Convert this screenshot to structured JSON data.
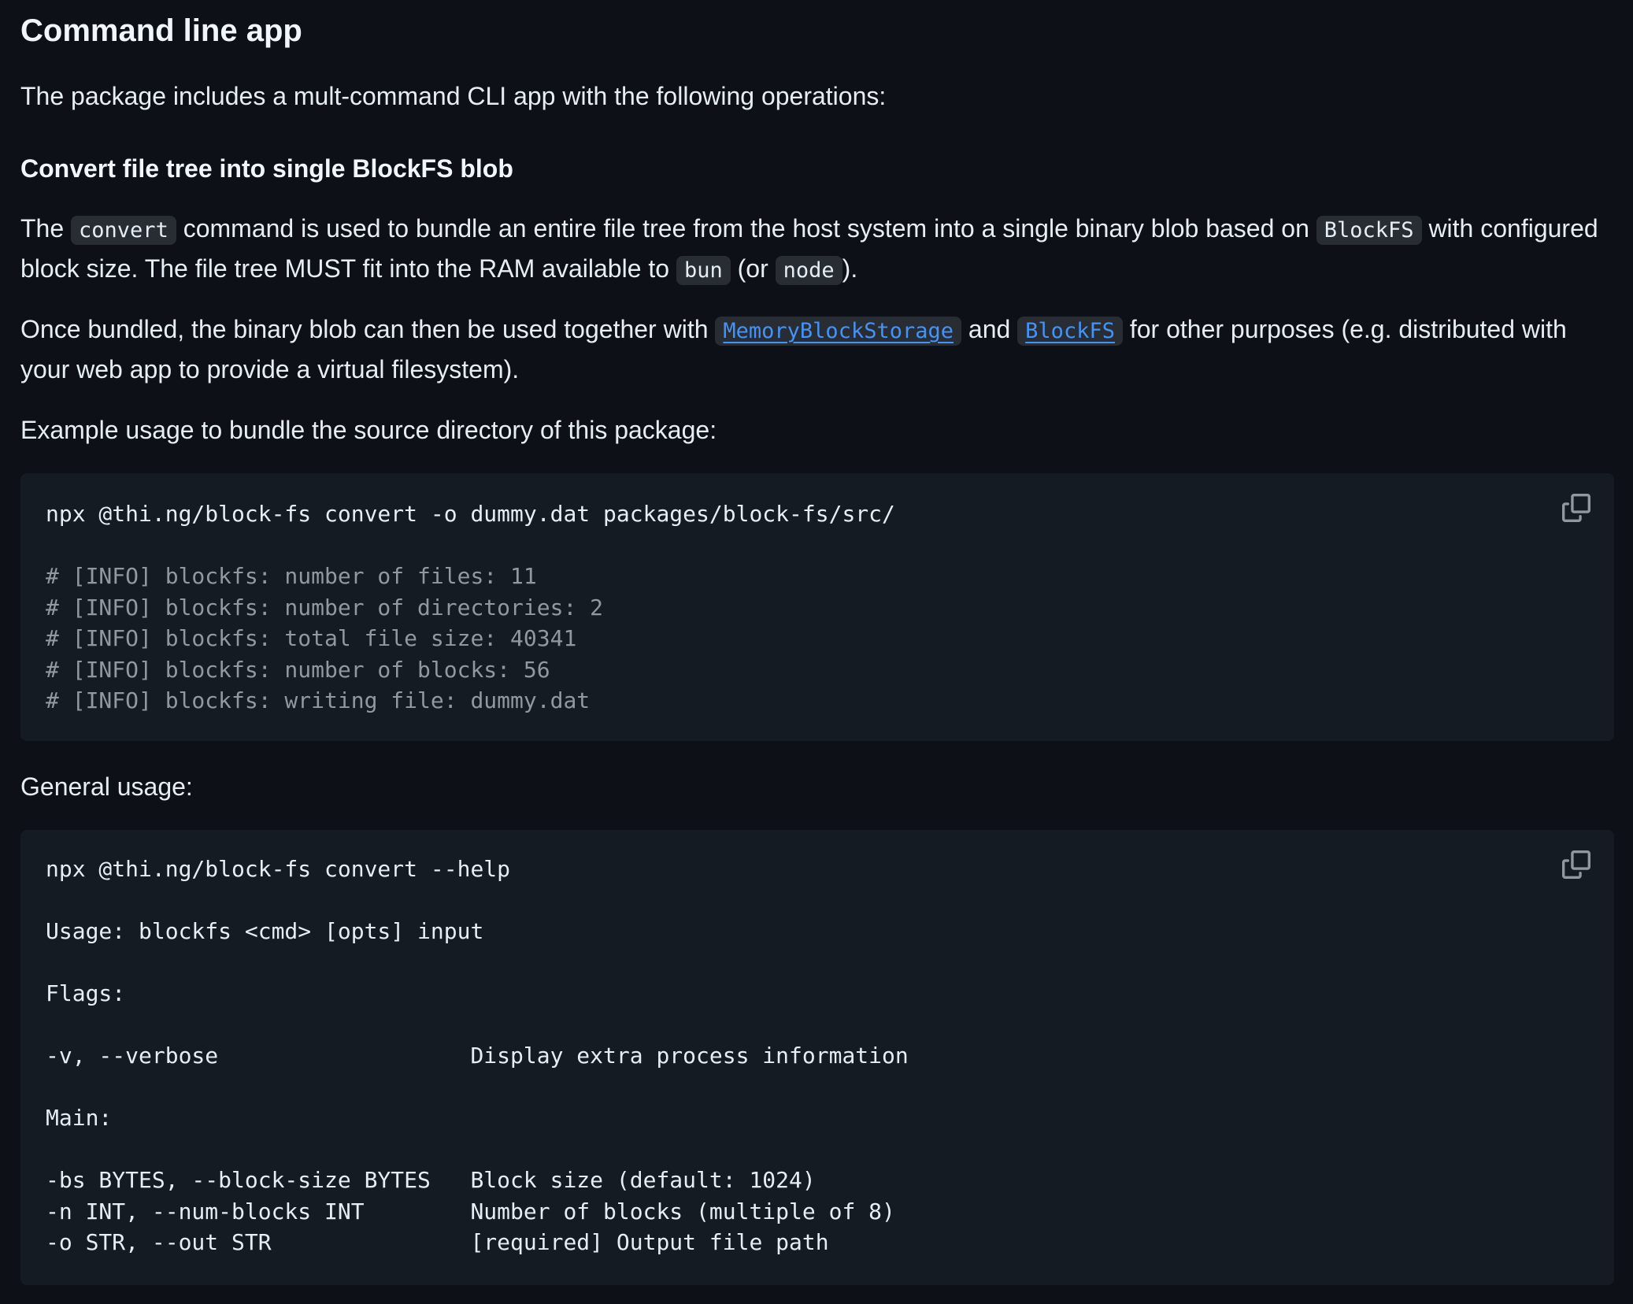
{
  "heading": "Command line app",
  "intro": "The package includes a mult-command CLI app with the following operations:",
  "subheading": "Convert file tree into single BlockFS blob",
  "para1": {
    "t1": "The ",
    "code1": "convert",
    "t2": " command is used to bundle an entire file tree from the host system into a single binary blob based on ",
    "code2": "BlockFS",
    "t3": " with configured block size. The file tree MUST fit into the RAM available to ",
    "code3": "bun",
    "t4": " (or ",
    "code4": "node",
    "t5": ")."
  },
  "para2": {
    "t1": "Once bundled, the binary blob can then be used together with ",
    "link1": "MemoryBlockStorage",
    "t2": " and ",
    "link2": "BlockFS",
    "t3": " for other purposes (e.g. distributed with your web app to provide a virtual filesystem)."
  },
  "example_label": "Example usage to bundle the source directory of this package:",
  "code_block_1": {
    "command": "npx @thi.ng/block-fs convert -o dummy.dat packages/block-fs/src/",
    "comments": [
      "# [INFO] blockfs: number of files: 11",
      "# [INFO] blockfs: number of directories: 2",
      "# [INFO] blockfs: total file size: 40341",
      "# [INFO] blockfs: number of blocks: 56",
      "# [INFO] blockfs: writing file: dummy.dat"
    ],
    "copy_icon": "copy-icon"
  },
  "general_label": "General usage:",
  "code_block_2": {
    "lines": [
      "npx @thi.ng/block-fs convert --help",
      "",
      "Usage: blockfs <cmd> [opts] input",
      "",
      "Flags:",
      "",
      "-v, --verbose                   Display extra process information",
      "",
      "Main:",
      "",
      "-bs BYTES, --block-size BYTES   Block size (default: 1024)",
      "-n INT, --num-blocks INT        Number of blocks (multiple of 8)",
      "-o STR, --out STR               [required] Output file path"
    ],
    "copy_icon": "copy-icon"
  },
  "colors": {
    "background": "#0d1117",
    "code_background": "#151b23",
    "text": "#e6edf3",
    "comment": "#9198a1",
    "link": "#4493f8"
  }
}
